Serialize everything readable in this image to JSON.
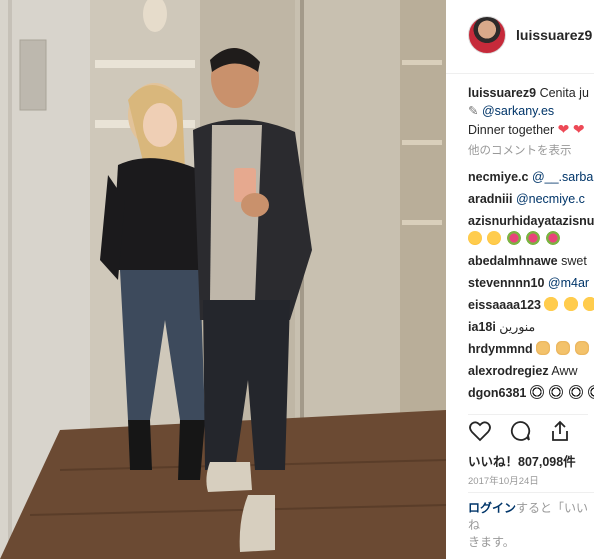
{
  "post": {
    "username": "luissuarez9",
    "caption_username": "luissuarez9",
    "caption_text": "Cenita ju",
    "caption_mention": "@sarkany.es",
    "caption_line2": "Dinner together",
    "view_comments": "他のコメントを表示"
  },
  "comments": [
    {
      "user": "necmiye.c",
      "text": "@__.sarba",
      "text_is_link": true
    },
    {
      "user": "aradniii",
      "text": "@necmiye.c",
      "text_is_link": true
    },
    {
      "user": "azisnurhidayatazisnu",
      "text": "",
      "emojis": [
        "smile",
        "smile",
        "flower",
        "flower",
        "flower"
      ]
    },
    {
      "user": "abedalmhnawe",
      "text": "swet"
    },
    {
      "user": "stevennnn10",
      "text": "@m4ar",
      "text_is_link": true
    },
    {
      "user": "eissaaaa123",
      "text": "",
      "emojis": [
        "heart-eyes",
        "heart-eyes",
        "heart-eyes"
      ]
    },
    {
      "user": "ia18i",
      "text": "منورين"
    },
    {
      "user": "hrdymmnd",
      "text": "",
      "emojis": [
        "ok",
        "ok",
        "ok"
      ]
    },
    {
      "user": "alexrodregiez",
      "text": "Aww"
    },
    {
      "user": "dgon6381",
      "text": "",
      "emojis": [
        "ball",
        "ball",
        "ball",
        "ball"
      ]
    }
  ],
  "likes": {
    "label": "いいね！807,098件"
  },
  "date": "2017年10月24日",
  "login": {
    "link": "ログイン",
    "text": "すると「いいね",
    "text2": "きます。"
  },
  "icons": {
    "like": "heart-outline-icon",
    "comment": "comment-bubble-icon",
    "share": "share-upload-icon"
  },
  "colors": {
    "link": "#003569",
    "muted": "#999999",
    "heart": "#ed4956"
  }
}
